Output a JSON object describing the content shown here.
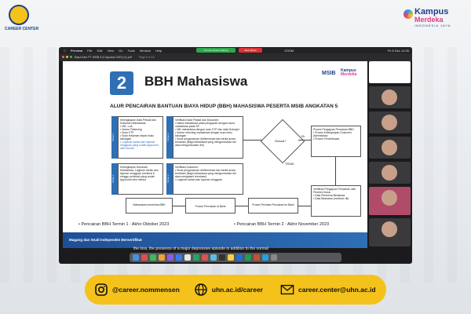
{
  "branding": {
    "left_logo_caption": "CAREER CENTER",
    "right_logo_line1": "Kampus",
    "right_logo_line2": "Merdeka",
    "right_logo_tagline": "INDONESIA JAYA"
  },
  "screen": {
    "menubar": {
      "app": "Preview",
      "items": [
        "File",
        "Edit",
        "View",
        "Go",
        "Tools",
        "Window",
        "Help"
      ],
      "clock": "Fri 8 Dec 14.56",
      "zoom_label": "ZOOM"
    },
    "share_bar": {
      "sharing_label": "You are screen sharing",
      "stop_label": "Stop Share"
    },
    "window_title": "Bapa Kam PT MSIB 5 (4 Agustus 2023) (1).pdf",
    "page_indicator": "Page 6 of 16",
    "slide": {
      "number": "2",
      "title": "BBH Mahasiswa",
      "msib_label": "MSIB",
      "km_line1": "Kampus",
      "km_line2": "Merdeka",
      "subtitle": "ALUR PENCAIRAN BANTUAN BIAYA HIDUP (BBH) MAHASISWA PESERTA MSIB ANGKATAN 5",
      "flow": {
        "box1_title": "Kelengkapan Data Pribadi dan Dokumen Mahasiswa:",
        "box1_items": [
          "NIK, LoA",
          "Nomor Rekening",
          "Scan KTP",
          "Scan Halaman depan buku tabungan",
          "Logbook harian dan laporan mingguan yang sudah Approved oleh mentor"
        ],
        "box1_tab": "Tahap 1",
        "box2_title": "Verifikasi Data Pribadi dan Dokumen:",
        "box2_items": [
          "Nama mahasiswa pada pengajuan dengan nama mahasiswa pada SK",
          "NIK mahasiswa dengan scan KTP dan data Dukcapil",
          "Nomor rekening mahasiswa dengan scan buku tabungan",
          "Surat pengunduran diri/terminasi dan berita acara terminasi (Bagi mahasiswa yang mengundurkan diri atau mengundurkan diri)"
        ],
        "box2_tab": "Tahap 2",
        "box3_title": "Kelengkapan Dokumen Mahasiswa: Logbook harian dan laporan mingguan (minimal 8 minggu pertama) yang sudah Approved oleh mentor",
        "box3_tab": "Tahap 1",
        "box4_items": [
          "Surat pengunduran diri/terminasi dan berita acara terminasi (Bagi mahasiswa yang mengundurkan diri atau mengalami terminasi)",
          "Logbook harian dan laporan mingguan"
        ],
        "box4_title": "Verifikasi Dokumen:",
        "box4_tab": "Tahap 2",
        "decision": "Sesuai?",
        "yes_label": "YA",
        "no_label": "TIDAK",
        "box5_title": "Proses Pengajuan Pencairan BBH",
        "box5_items": [
          "Proses Kelengkapan Dokumen Administrasi",
          "Proses Pemeriksaan"
        ],
        "box6_title": "Verifikasi Pengajuan Pencairan oleh Pemberi Dana",
        "box6_items": [
          "Data Penerima Beasiswa",
          "Data Beasiswa (nominal, dll)"
        ],
        "box7": "Proses Perintah Pencairan ke Bank",
        "box8": "Proses Pencairan di Bank",
        "box9": "Mahasiswa menerima BBH"
      },
      "bullet1": "Pencairan BBH Termin 1 : Akhir Oktober 2023",
      "bullet2": "Pencairan BBH Termin 2 : Akhir November 2023",
      "banner": "Magang dan Studi Independen Bersertifikat"
    },
    "caption": "the loss, the presence of a major depressive episode in addition to the normal"
  },
  "footer": {
    "instagram": "@career.nommensen",
    "website": "uhn.ac.id/career",
    "email": "career.center@uhn.ac.id"
  },
  "colors": {
    "accent": "#2f6fb5",
    "footer_bg": "#f4c21a",
    "brand_pink": "#e23b8a"
  }
}
